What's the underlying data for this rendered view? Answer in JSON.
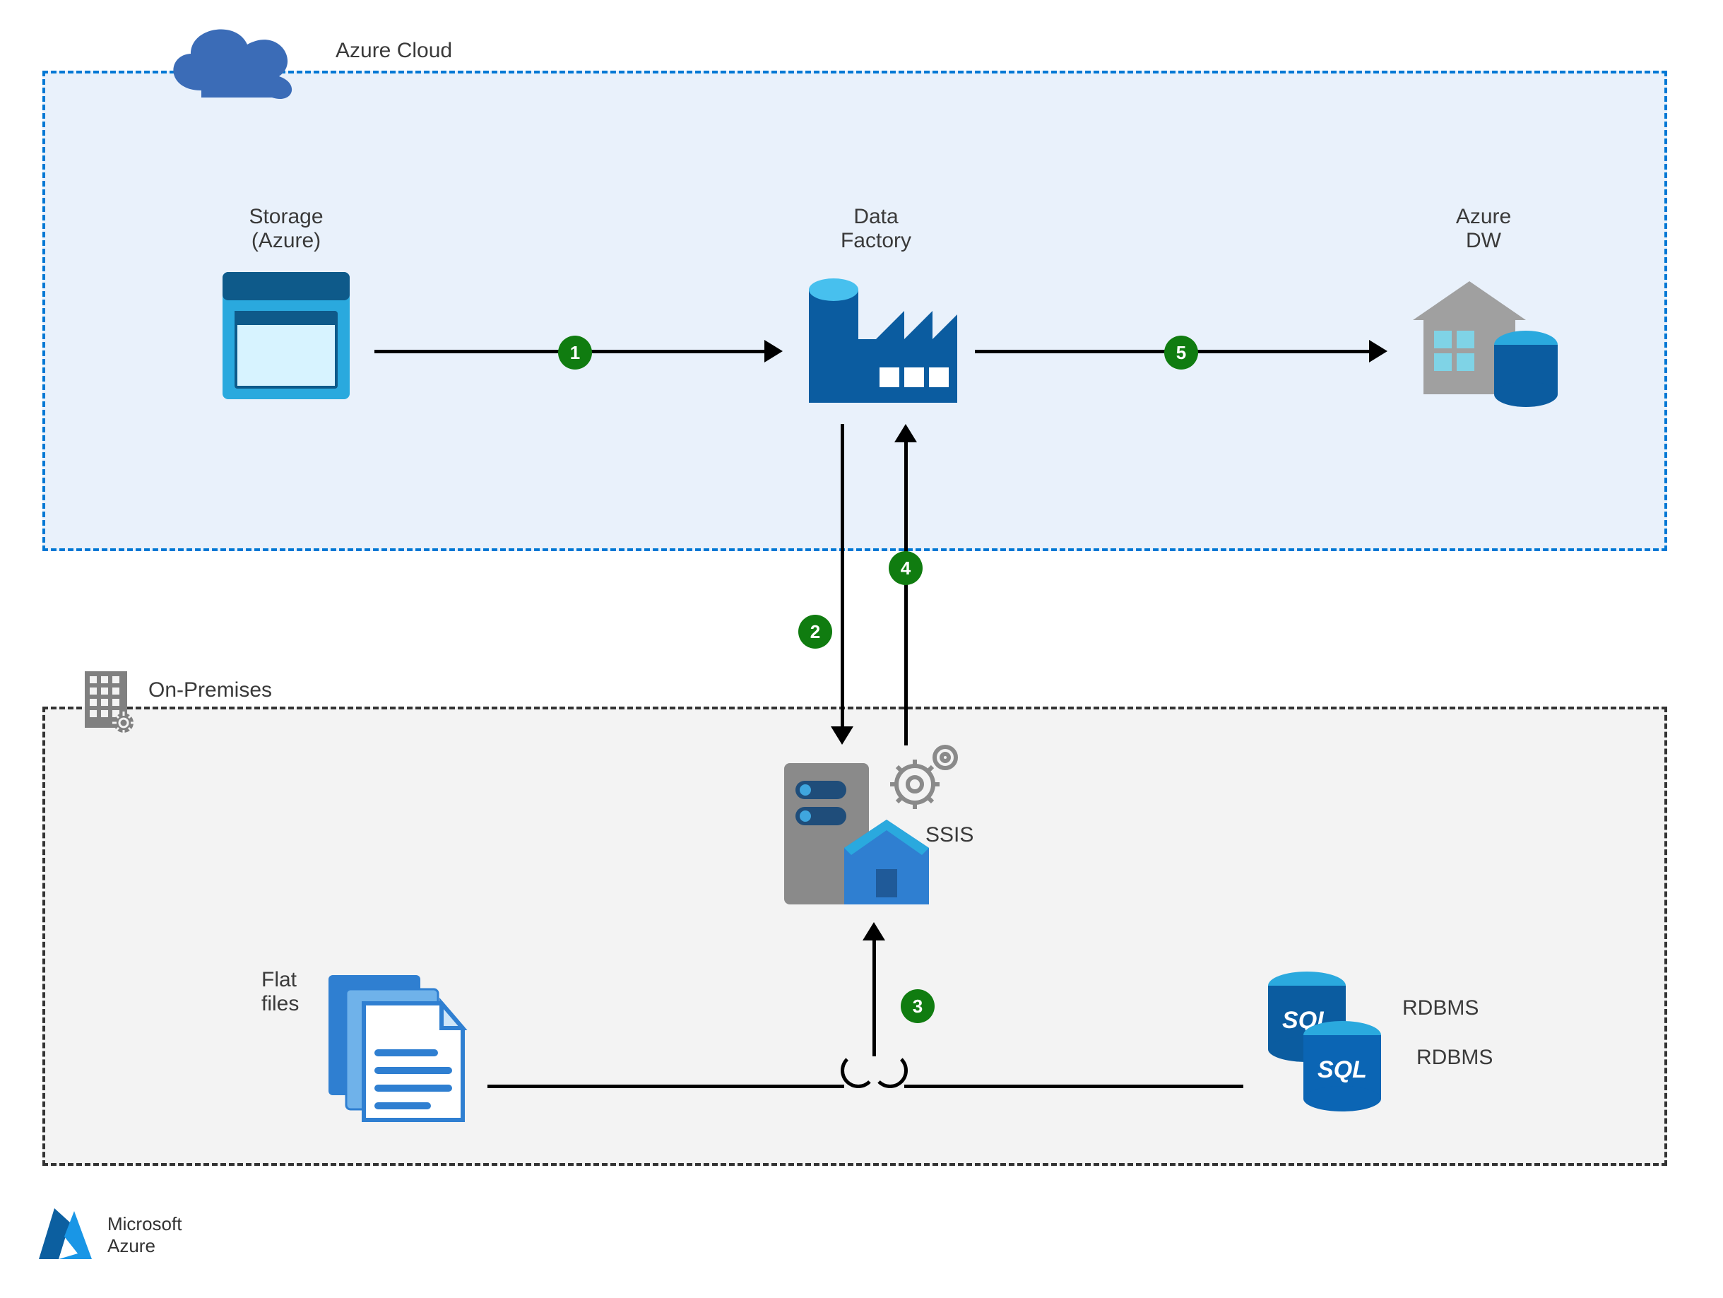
{
  "regions": {
    "azure_cloud": {
      "label": "Azure Cloud"
    },
    "on_premises": {
      "label": "On-Premises"
    }
  },
  "nodes": {
    "storage": {
      "label_line1": "Storage",
      "label_line2": "(Azure)"
    },
    "data_factory": {
      "label_line1": "Data",
      "label_line2": "Factory"
    },
    "azure_dw": {
      "label_line1": "Azure",
      "label_line2": "DW"
    },
    "ssis": {
      "label": "SSIS"
    },
    "flat_files": {
      "label_line1": "Flat",
      "label_line2": "files"
    },
    "rdbms1": {
      "label": "RDBMS"
    },
    "rdbms2": {
      "label": "RDBMS"
    }
  },
  "steps": {
    "s1": "1",
    "s2": "2",
    "s3": "3",
    "s4": "4",
    "s5": "5"
  },
  "footer": {
    "line1": "Microsoft",
    "line2": "Azure"
  }
}
